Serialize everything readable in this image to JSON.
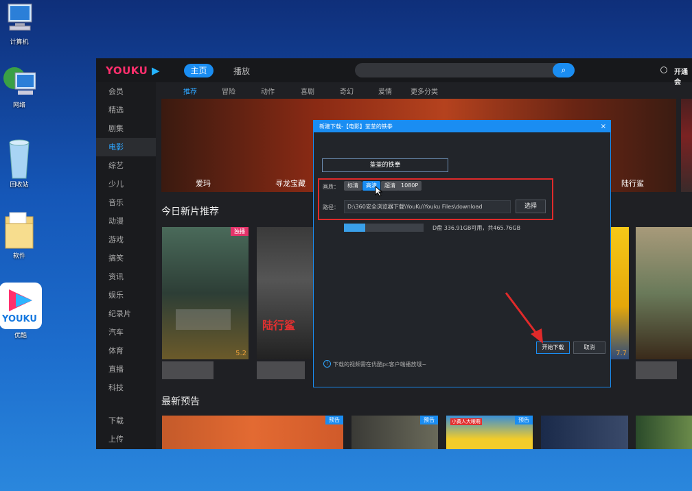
{
  "desktop": {
    "icons": [
      {
        "label": "计算机"
      },
      {
        "label": "网络"
      },
      {
        "label": "回收站"
      },
      {
        "label": "软件"
      },
      {
        "label": "优酷"
      }
    ],
    "youku_icon_text": "YOUKU"
  },
  "app": {
    "logo": "YOUKU",
    "nav": {
      "home": "主页",
      "play": "播放"
    },
    "vip": "开通会",
    "sidebar": [
      "会员",
      "精选",
      "剧集",
      "电影",
      "综艺",
      "少儿",
      "音乐",
      "动漫",
      "游戏",
      "搞笑",
      "资讯",
      "娱乐",
      "纪录片",
      "汽车",
      "体育",
      "直播",
      "科技"
    ],
    "sidebar_active": "电影",
    "sidebar_bottom": [
      "下载",
      "上传"
    ],
    "subnav": [
      "推荐",
      "冒险",
      "动作",
      "喜剧",
      "奇幻",
      "爱情",
      "更多分类"
    ],
    "banner_captions": [
      "爱玛",
      "寻龙宝藏",
      "陆行鲨"
    ],
    "section_today": "今日新片推荐",
    "section_trailer": "最新预告",
    "posters": [
      {
        "badge": "独播",
        "rating": "5.2",
        "title": "陆行鲨"
      },
      {
        "rating": "7.7"
      }
    ],
    "trailer_badge": "预告",
    "trailer_text": "小黄人大眼萌"
  },
  "dialog": {
    "title": "新建下载-【电影】荃荃的铁拳",
    "close": "×",
    "name": "荃荃的铁拳",
    "quality_label": "画质：",
    "qualities": [
      "标清",
      "高清",
      "超清",
      "1080P"
    ],
    "quality_selected": "高清",
    "path_label": "路径：",
    "path": "D:\\360安全浏览器下载\\YouKu\\Youku Files\\download",
    "choose": "选择",
    "disk_used_fraction": 0.27,
    "disk_text": "D盘 336.91GB可用，共465.76GB",
    "start": "开始下载",
    "cancel": "取消",
    "tip": "下载的视频需在优酷pc客户端播放哦~"
  }
}
